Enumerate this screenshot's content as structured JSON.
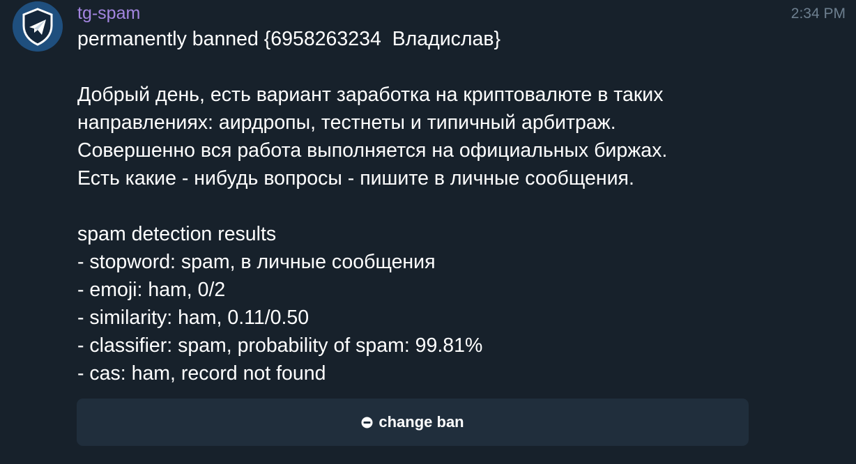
{
  "sender": {
    "name": "tg-spam",
    "avatar_icon": "shield-paper-plane-icon",
    "name_color": "#a385e0"
  },
  "time": "2:34 PM",
  "message": {
    "lines": [
      "permanently banned {6958263234  Владислав}",
      "",
      "Добрый день, есть вариант заработка на криптовалюте в таких",
      "направлениях: аирдропы, тестнеты и типичный арбитраж.",
      "Совершенно вся работа выполняется на официальных биржах.",
      "Есть какие - нибудь вопросы - пишите в личные сообщения.",
      "",
      "spam detection results",
      "- stopword: spam, в личные сообщения",
      "- emoji: ham, 0/2",
      "- similarity: ham, 0.11/0.50",
      "- classifier: spam, probability of spam: 99.81%",
      "- cas: ham, record not found"
    ]
  },
  "button": {
    "icon": "minus-circle-icon",
    "label": "change ban"
  },
  "colors": {
    "background": "#17212b",
    "button_background": "#202e3c",
    "time": "#6d7f8f"
  }
}
